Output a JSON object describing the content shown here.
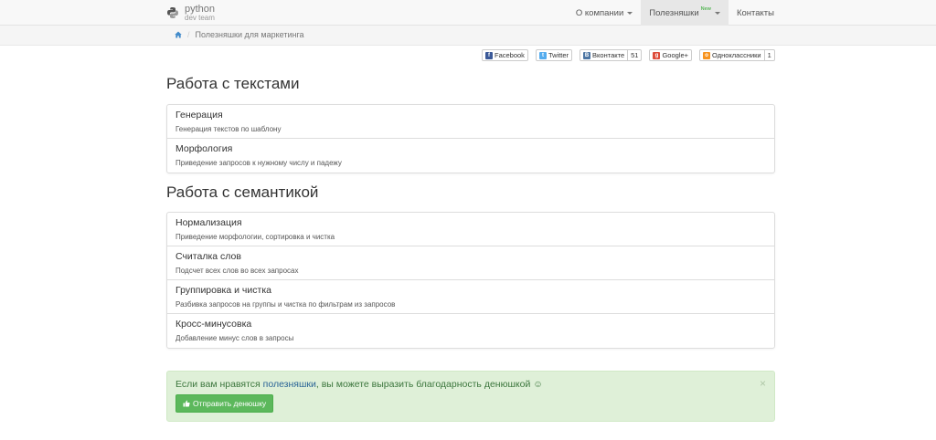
{
  "navbar": {
    "brand_line1": "python",
    "brand_line2": "dev team",
    "items": [
      {
        "label": "О компании",
        "dropdown": true,
        "active": false
      },
      {
        "label": "Полезняшки",
        "badge": "New",
        "dropdown": true,
        "active": true
      },
      {
        "label": "Контакты",
        "dropdown": false,
        "active": false
      }
    ]
  },
  "breadcrumb": {
    "current": "Полезняшки для маркетинга"
  },
  "share": [
    {
      "label": "Facebook",
      "icon": "facebook-icon",
      "color": "#3b5998"
    },
    {
      "label": "Twitter",
      "icon": "twitter-icon",
      "color": "#55acee"
    },
    {
      "label": "Вконтакте",
      "icon": "vk-icon",
      "color": "#4c75a3",
      "count": "51"
    },
    {
      "label": "Google+",
      "icon": "google-plus-icon",
      "color": "#dd4b39"
    },
    {
      "label": "Одноклассники",
      "icon": "odnoklassniki-icon",
      "color": "#f7931e",
      "count": "1"
    }
  ],
  "sections": [
    {
      "title": "Работа с текстами",
      "items": [
        {
          "title": "Генерация",
          "desc": "Генерация текстов по шаблону"
        },
        {
          "title": "Морфология",
          "desc": "Приведение запросов к нужному числу и падежу"
        }
      ]
    },
    {
      "title": "Работа с семантикой",
      "items": [
        {
          "title": "Нормализация",
          "desc": "Приведение морфологии, сортировка и чистка"
        },
        {
          "title": "Считалка слов",
          "desc": "Подсчет всех слов во всех запросах"
        },
        {
          "title": "Группировка и чистка",
          "desc": "Разбивка запросов на группы и чистка по фильтрам из запросов"
        },
        {
          "title": "Кросс-минусовка",
          "desc": "Добавление минус слов в запросы"
        }
      ]
    }
  ],
  "alert": {
    "text_before": "Если вам нравятся ",
    "link": "полезняшки",
    "text_after": ", вы можете выразить благодарность денюшкой ☺",
    "close": "×",
    "button": "Отправить денюшку"
  },
  "colors": {
    "accent_green": "#5cb85c",
    "alert_bg": "#dff0d8"
  }
}
